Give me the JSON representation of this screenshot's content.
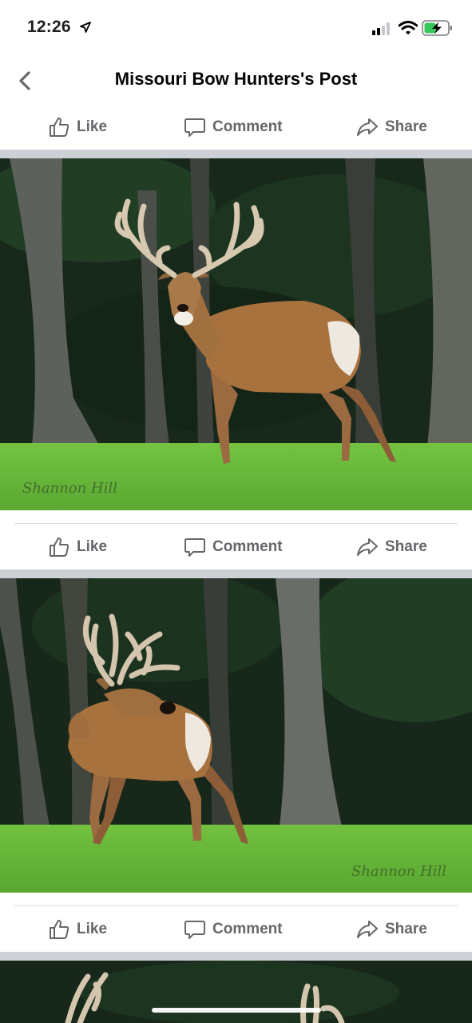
{
  "status_bar": {
    "time": "12:26",
    "battery_charging": true
  },
  "header": {
    "title": "Missouri Bow Hunters's Post",
    "back_icon": "chevron-left-icon"
  },
  "actions": {
    "like": "Like",
    "comment": "Comment",
    "share": "Share"
  },
  "photos": [
    {
      "watermark": "Shannon Hill"
    },
    {
      "watermark": "Shannon Hill"
    }
  ],
  "colors": {
    "action_text": "#65676b",
    "separator": "#cdd0d4",
    "grass": "#6fbf3c",
    "forest": "#17281a"
  }
}
